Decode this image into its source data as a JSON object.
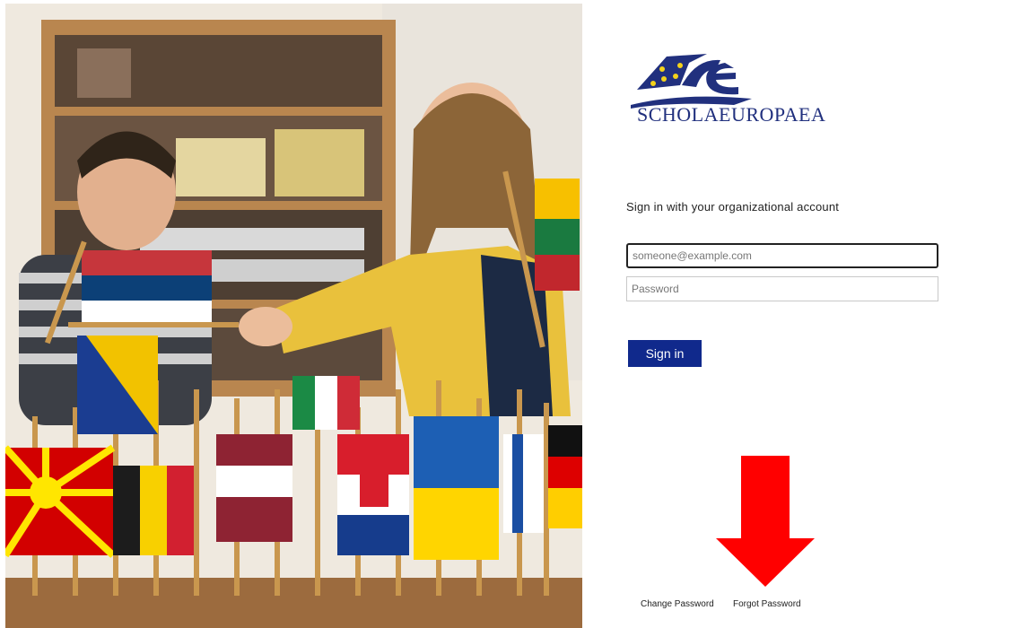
{
  "logo": {
    "name": "SCHOLA EUROPAEA",
    "mark": "SE",
    "text": "SCHOLAEUROPAEA"
  },
  "form": {
    "heading": "Sign in with your organizational account",
    "username_placeholder": "someone@example.com",
    "password_placeholder": "Password",
    "signin_label": "Sign in"
  },
  "footer": {
    "change_password": "Change Password",
    "forgot_password": "Forgot Password"
  },
  "colors": {
    "brand_blue": "#10298c",
    "annotation_arrow": "#ff0000"
  },
  "illustration": {
    "description_icon": "photo-children-with-flags"
  }
}
